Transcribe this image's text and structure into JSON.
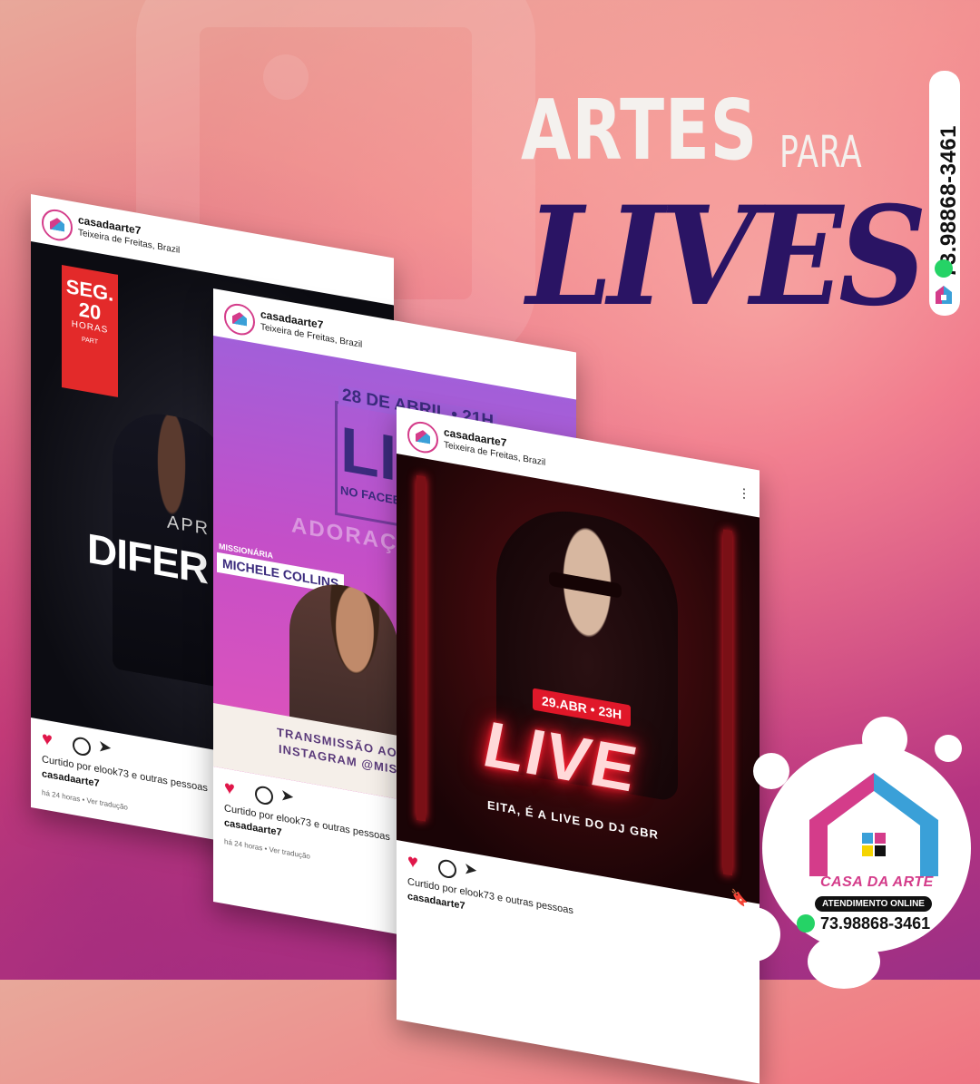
{
  "headline": {
    "line1": "ARTES",
    "line1b": "PARA",
    "line2": "LIVES"
  },
  "side_contact": {
    "phone": "73.98868-3461"
  },
  "posts": [
    {
      "username": "casadaarte7",
      "location": "Teixeira de Freitas, Brazil",
      "art": {
        "day": "SEG.",
        "hour": "20",
        "horas": "HORAS",
        "part": "PART",
        "headline_partial": "DIFER",
        "top_partial": "APR"
      },
      "liked_by": "Curtido por elook73 e outras pessoas",
      "owner": "casadaarte7",
      "time": "há 24 horas • Ver tradução"
    },
    {
      "username": "casadaarte7",
      "location": "Teixeira de Freitas, Brazil",
      "art": {
        "date": "28 DE ABRIL • 21H",
        "big_partial": "LI",
        "no_face_partial": "NO FACEB",
        "adoracao_partial": "ADORAÇÃ",
        "missionaria": "MISSIONÁRIA",
        "name": "MICHELE COLLINS",
        "transmissao_partial": "TRANSMISSÃO AO",
        "instagram_partial": "INSTAGRAM @MISS"
      },
      "liked_by": "Curtido por elook73 e outras pessoas",
      "owner": "casadaarte7",
      "time": "há 24 horas • Ver tradução"
    },
    {
      "username": "casadaarte7",
      "location": "Teixeira de Freitas, Brazil",
      "art": {
        "date": "29.ABR • 23H",
        "live": "LIVE",
        "subtitle": "EITA, É A LIVE DO DJ GBR"
      },
      "liked_by": "Curtido por elook73 e outras pessoas",
      "owner": "casadaarte7",
      "time": ""
    }
  ],
  "brand": {
    "name": "CASA DA ARTE",
    "service": "ATENDIMENTO ONLINE",
    "phone": "73.98868-3461"
  },
  "colors": {
    "accent_pink": "#d43c8a",
    "accent_blue": "#3aa0d8",
    "headline_purple": "#2a1464",
    "like_red": "#e0174a",
    "whatsapp_green": "#25d366"
  }
}
